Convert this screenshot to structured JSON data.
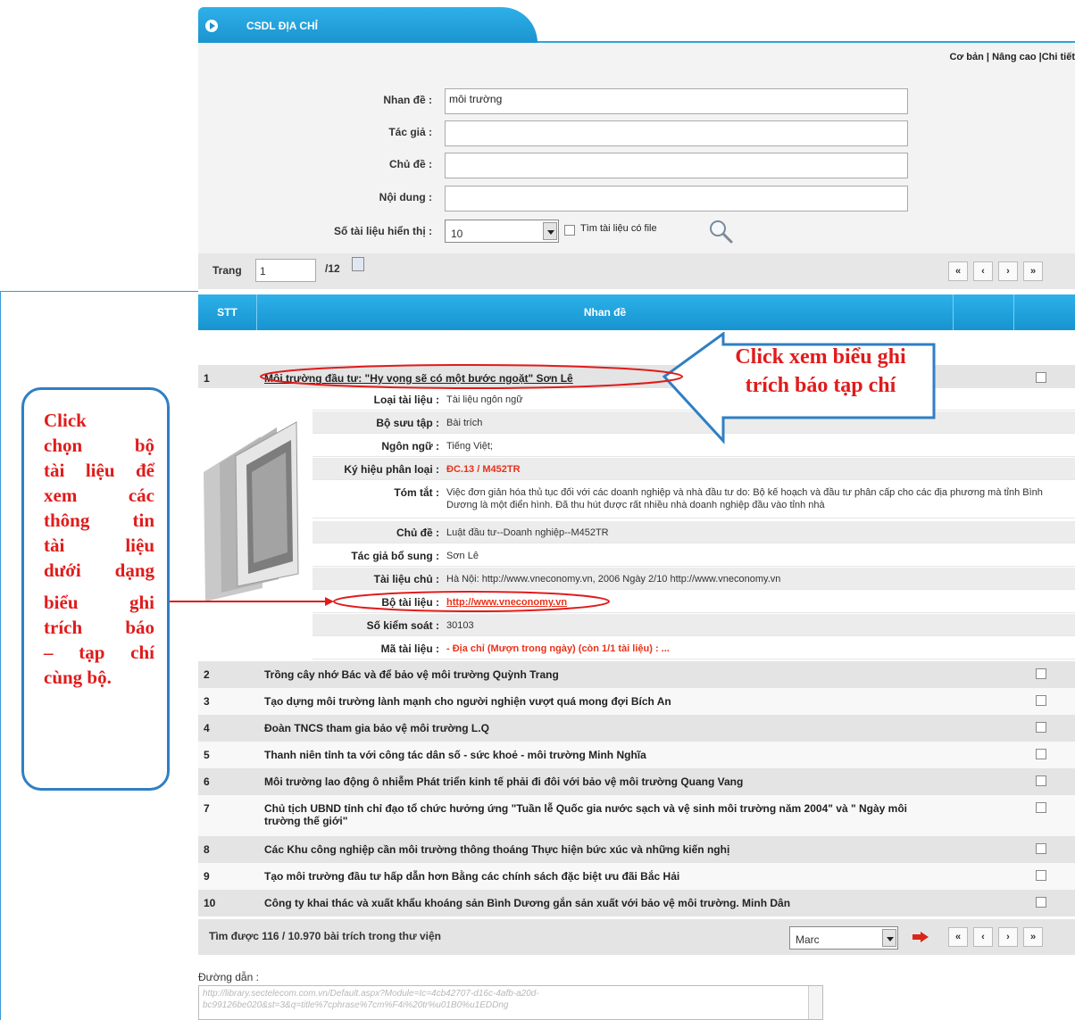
{
  "tab": {
    "title": "CSDL ĐỊA CHỈ"
  },
  "modes": {
    "basic": "Cơ bản",
    "sep1": "|",
    "advanced": "Nâng cao",
    "sep2": "|",
    "detail": "Chi tiết"
  },
  "form": {
    "title_label": "Nhan đề :",
    "title_value": "môi trường",
    "author_label": "Tác giả :",
    "author_value": "",
    "subject_label": "Chủ đề :",
    "subject_value": "",
    "content_label": "Nội dung :",
    "content_value": "",
    "count_label": "Số tài liệu hiển thị :",
    "count_value": "10",
    "file_label": "Tìm tài liệu có file"
  },
  "pagination": {
    "label": "Trang",
    "current": "1",
    "total": "/12",
    "first": "«",
    "prev": "‹",
    "next": "›",
    "last": "»"
  },
  "table": {
    "col_stt": "STT",
    "col_title": "Nhan đề"
  },
  "rows": [
    {
      "num": "1",
      "title": "Môi trường đầu tư: \"Hy vọng sẽ có một bước ngoặt\" Sơn Lê"
    },
    {
      "num": "2",
      "title": "Trồng cây nhớ Bác và để bảo vệ môi trường Quỳnh Trang"
    },
    {
      "num": "3",
      "title": "Tạo dựng môi trường lành mạnh cho người nghiện vượt quá mong đợi Bích An"
    },
    {
      "num": "4",
      "title": "Đoàn TNCS tham gia bảo vệ môi trường L.Q"
    },
    {
      "num": "5",
      "title": "Thanh niên tỉnh ta với công tác dân số - sức khoẻ - môi trường Minh Nghĩa"
    },
    {
      "num": "6",
      "title": "Môi trường lao động ô nhiễm Phát triển kinh tế phải đi đôi với bảo vệ môi trường Quang Vang"
    },
    {
      "num": "7",
      "title": "Chủ tịch UBND tỉnh chỉ đạo tổ chức hưởng ứng \"Tuần lễ Quốc gia nước sạch và vệ sinh môi trường năm 2004\" và \" Ngày môi trường thế giới\""
    },
    {
      "num": "8",
      "title": "Các Khu công nghiệp cần môi trường thông thoáng Thực hiện bức xúc và những kiến nghị"
    },
    {
      "num": "9",
      "title": "Tạo môi trường đầu tư hấp dẫn hơn Bằng các chính sách đặc biệt ưu đãi Bắc Hải"
    },
    {
      "num": "10",
      "title": "Công ty khai thác và xuất khẩu khoáng sản Bình Dương gắn sản xuất với bảo vệ môi trường. Minh Dân"
    }
  ],
  "detail": [
    {
      "label": "Loại tài liệu :",
      "value": "Tài liệu ngôn ngữ"
    },
    {
      "label": "Bộ sưu tập :",
      "value": "Bài trích"
    },
    {
      "label": "Ngôn ngữ :",
      "value": "Tiếng Việt;"
    },
    {
      "label": "Ký hiệu phân loại :",
      "value": "ĐC.13 / M452TR"
    },
    {
      "label": "Tóm tắt :",
      "value": "Việc đơn giản hóa thủ tục đối với các doanh nghiệp và nhà đầu tư do: Bộ kế hoạch và đầu tư phân cấp cho các địa phương mà tỉnh Bình Dương là một điển hình. Đã thu hút được rất nhiều nhà doanh nghiệp đầu vào tỉnh nhà"
    },
    {
      "label": "Chủ đề :",
      "value": "Luật đầu tư--Doanh nghiệp--M452TR"
    },
    {
      "label": "Tác giả bổ sung :",
      "value": "Sơn Lê"
    },
    {
      "label": "Tài liệu chủ :",
      "value": "Hà Nội: http://www.vneconomy.vn, 2006 Ngày 2/10 http://www.vneconomy.vn"
    },
    {
      "label": "Bộ tài liệu :",
      "value": "http://www.vneconomy.vn"
    },
    {
      "label": "Số kiểm soát :",
      "value": "30103"
    },
    {
      "label": "Mã tài liệu :",
      "value": "- Địa chỉ (Mượn trong ngày) (còn 1/1 tài liệu) : ..."
    }
  ],
  "footer": {
    "found": "Tìm được 116 / 10.970 bài trích trong thư viện",
    "format": "Marc"
  },
  "path": {
    "label": "Đường dẫn :",
    "value": "http://library.sectelecom.com.vn/Default.aspx?Module=Ic=4cb42707-d16c-4afb-a20d-bc99126be020&st=3&q=title%7cphrase%7cm%F4i%20tr%u01B0%u1EDDng"
  },
  "annotations": {
    "left_note": [
      "Click",
      "chọn bộ",
      "tài liệu để",
      "xem các",
      "thông tin",
      "tài liệu",
      "dưới dạng",
      "biểu ghi",
      "trích báo",
      "– tạp chí",
      "cùng bộ."
    ],
    "callout": "Click xem biểu ghi trích báo tạp chí"
  },
  "colors": {
    "header_blue": "#1a94cf",
    "annotation_red": "#e01b1b",
    "note_border": "#2f7fc4"
  }
}
